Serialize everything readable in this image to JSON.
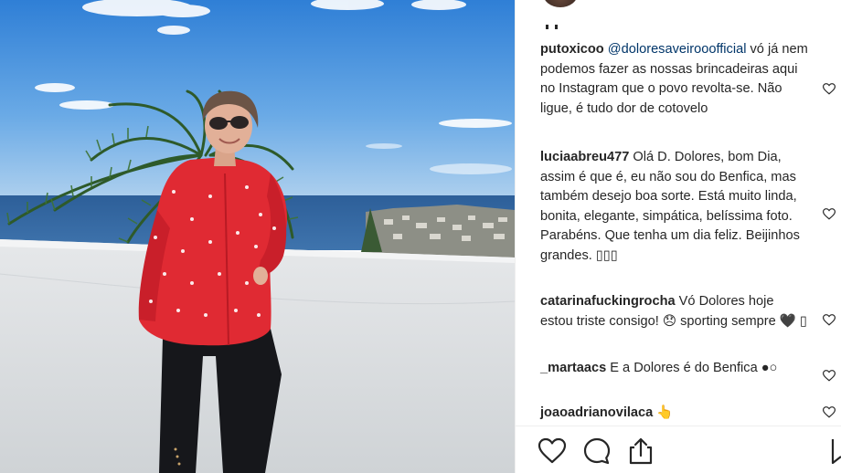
{
  "post": {
    "comments": [
      {
        "user": "putoxicoo",
        "mention": "@doloresaveirooofficial",
        "text": " vó já nem podemos fazer as nossas brincadeiras aqui no Instagram que o povo revolta-se. Não ligue, é tudo dor de cotovelo"
      },
      {
        "user": "luciaabreu477",
        "text": " Olá D. Dolores, bom Dia, assim é que é, eu não sou do Benfica, mas também desejo boa sorte. Está muito linda, bonita, elegante, simpática, belíssima foto. Parabéns. Que tenha um dia feliz. Beijinhos grandes. ▯▯▯"
      },
      {
        "user": "catarinafuckingrocha",
        "text": " Vó Dolores hoje estou triste consigo! 😞 sporting sempre 🖤 ▯"
      },
      {
        "user": "_martaacs",
        "text": " E a Dolores é do Benfica ●○"
      },
      {
        "user": "joaoadrianovilaca",
        "text": " 👆"
      }
    ]
  },
  "icons": {
    "like": "heart-icon",
    "comment": "comment-icon",
    "share": "share-icon",
    "save": "bookmark-icon"
  },
  "colors": {
    "text": "#262626",
    "mention": "#003569",
    "divider": "#efefef"
  }
}
